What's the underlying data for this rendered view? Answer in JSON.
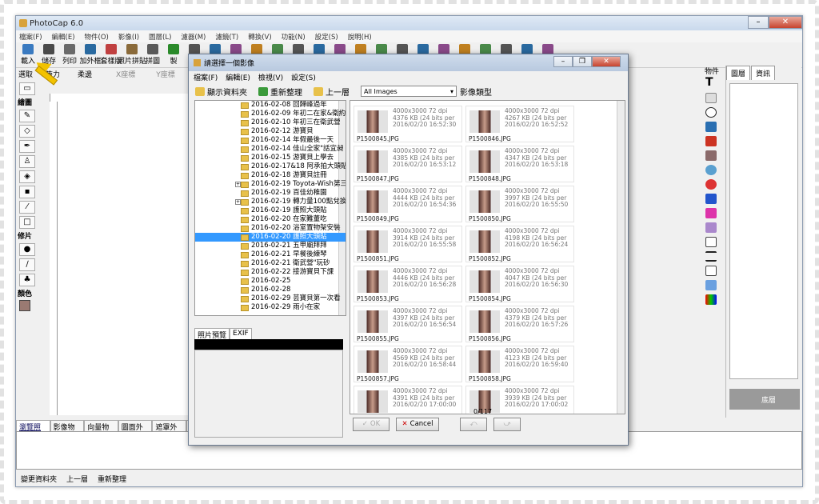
{
  "app": {
    "title": "PhotoCap 6.0"
  },
  "menu": [
    "檔案(F)",
    "編輯(E)",
    "物件(O)",
    "影像(I)",
    "圖層(L)",
    "濾器(M)",
    "濾鏡(T)",
    "轉換(V)",
    "功能(N)",
    "設定(S)",
    "說明(H)"
  ],
  "toolbar": [
    "載入",
    "儲存",
    "列印",
    "加外框",
    "套樣版",
    "照片拼貼",
    "拼圖",
    "製"
  ],
  "row2": {
    "select": "選取",
    "pen": "筆力",
    "color": "柔邊",
    "xdir": "X座標",
    "ydir": "Y座標",
    "opacity": "100",
    "zoom": "100%"
  },
  "left": {
    "draw": "繪圖",
    "repair": "修片",
    "color": "顏色"
  },
  "right": {
    "label": "物件",
    "tabs": [
      "圖層",
      "資訊"
    ],
    "layer": "底層"
  },
  "bottomtabs": [
    "瀏覽照片",
    "影像物件",
    "向量物件",
    "圖面外框",
    "遮罩外框",
    "標"
  ],
  "status": [
    "變更資料夾",
    "上一層",
    "重新整理"
  ],
  "dialog": {
    "title": "請選擇一個影像",
    "menu": [
      "檔案(F)",
      "編輯(E)",
      "檢視(V)",
      "設定(S)"
    ],
    "show_folder": "顯示資料夾",
    "refresh": "重新整理",
    "up": "上一層",
    "filter": "All Images",
    "filter_label": "影像類型",
    "preview_tabs": [
      "照片預覽",
      "EXIF"
    ],
    "count": "0/117",
    "ok": "OK",
    "cancel": "Cancel",
    "folders": [
      {
        "name": "2016-02-08 回歸峰過年"
      },
      {
        "name": "2016-02-09 年初二在家&衛約"
      },
      {
        "name": "2016-02-10 年初三在衛武營"
      },
      {
        "name": "2016-02-12 游寶貝"
      },
      {
        "name": "2016-02-14 年假最後一天"
      },
      {
        "name": "2016-02-14 佳山全家\"話宜昶"
      },
      {
        "name": "2016-02-15 游寶貝上學去"
      },
      {
        "name": "2016-02-17&18 阿承拍大頭貼"
      },
      {
        "name": "2016-02-18 游寶貝註冊"
      },
      {
        "name": "2016-02-19 Toyota-Wish第三"
      },
      {
        "name": "2016-02-19 百佳幼稚園"
      },
      {
        "name": "2016-02-19 轉力量100點兌換"
      },
      {
        "name": "2016-02-19 護照大頭貼"
      },
      {
        "name": "2016-02-20 在家難董吃"
      },
      {
        "name": "2016-02-20 浴室置物架安裝"
      },
      {
        "name": "2016-02-20 護照大頭貼"
      },
      {
        "name": "2016-02-21 五甲廟拜拜"
      },
      {
        "name": "2016-02-21 早餐後練琴"
      },
      {
        "name": "2016-02-21 衛武營\"玩砂"
      },
      {
        "name": "2016-02-22 接游寶貝下課"
      },
      {
        "name": "2016-02-25"
      },
      {
        "name": "2016-02-28"
      },
      {
        "name": "2016-02-29 芸寶貝第一次看"
      },
      {
        "name": "2016-02-29 雨小在家"
      }
    ],
    "files": [
      {
        "name": "P1500845.JPG",
        "dim": "4000x3000 72 dpi",
        "size": "4376 KB (24 bits per",
        "date": "2016/02/20 16:52:30"
      },
      {
        "name": "P1500846.JPG",
        "dim": "4000x3000 72 dpi",
        "size": "4267 KB (24 bits per",
        "date": "2016/02/20 16:52:52"
      },
      {
        "name": "P1500847.JPG",
        "dim": "4000x3000 72 dpi",
        "size": "4385 KB (24 bits per",
        "date": "2016/02/20 16:53:12"
      },
      {
        "name": "P1500848.JPG",
        "dim": "4000x3000 72 dpi",
        "size": "4347 KB (24 bits per",
        "date": "2016/02/20 16:53:18"
      },
      {
        "name": "P1500849.JPG",
        "dim": "4000x3000 72 dpi",
        "size": "4444 KB (24 bits per",
        "date": "2016/02/20 16:54:36"
      },
      {
        "name": "P1500850.JPG",
        "dim": "4000x3000 72 dpi",
        "size": "3997 KB (24 bits per",
        "date": "2016/02/20 16:55:50"
      },
      {
        "name": "P1500851.JPG",
        "dim": "4000x3000 72 dpi",
        "size": "3914 KB (24 bits per",
        "date": "2016/02/20 16:55:58"
      },
      {
        "name": "P1500852.JPG",
        "dim": "4000x3000 72 dpi",
        "size": "4198 KB (24 bits per",
        "date": "2016/02/20 16:56:24"
      },
      {
        "name": "P1500853.JPG",
        "dim": "4000x3000 72 dpi",
        "size": "4446 KB (24 bits per",
        "date": "2016/02/20 16:56:28"
      },
      {
        "name": "P1500854.JPG",
        "dim": "4000x3000 72 dpi",
        "size": "4047 KB (24 bits per",
        "date": "2016/02/20 16:56:30"
      },
      {
        "name": "P1500855.JPG",
        "dim": "4000x3000 72 dpi",
        "size": "4397 KB (24 bits per",
        "date": "2016/02/20 16:56:54"
      },
      {
        "name": "P1500856.JPG",
        "dim": "4000x3000 72 dpi",
        "size": "4379 KB (24 bits per",
        "date": "2016/02/20 16:57:26"
      },
      {
        "name": "P1500857.JPG",
        "dim": "4000x3000 72 dpi",
        "size": "4569 KB (24 bits per",
        "date": "2016/02/20 16:58:44"
      },
      {
        "name": "P1500858.JPG",
        "dim": "4000x3000 72 dpi",
        "size": "4123 KB (24 bits per",
        "date": "2016/02/20 16:59:40"
      },
      {
        "name": "",
        "dim": "4000x3000 72 dpi",
        "size": "4391 KB (24 bits per",
        "date": "2016/02/20 17:00:00"
      },
      {
        "name": "",
        "dim": "4000x3000 72 dpi",
        "size": "3939 KB (24 bits per",
        "date": "2016/02/20 17:00:02"
      }
    ]
  },
  "colors": {
    "accent": "#3399ff",
    "arrow": "#f2c200"
  }
}
